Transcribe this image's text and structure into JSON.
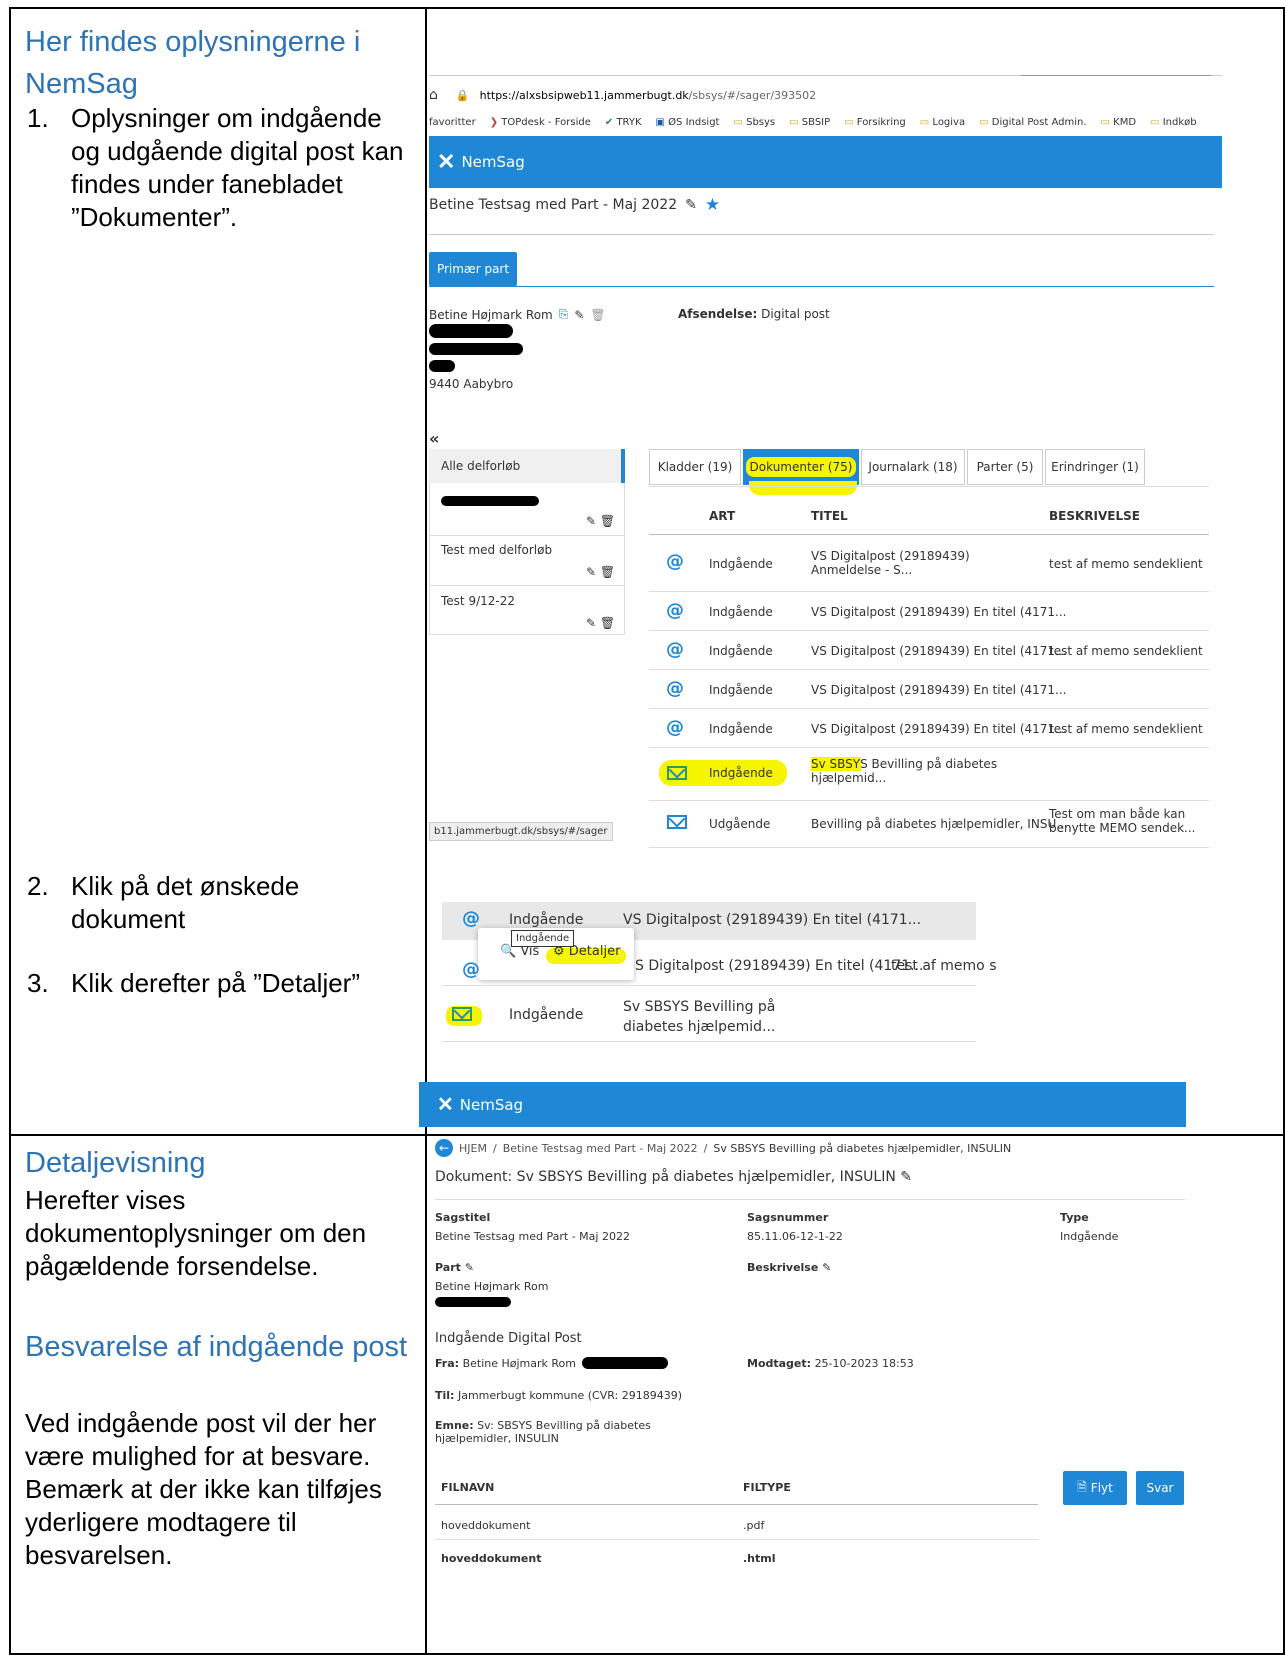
{
  "left": {
    "section1_heading": "Her findes oplysningerne i NemSag",
    "step1_num": "1.",
    "step1_text": "Oplysninger om indgående og udgående digital post kan findes under fanebladet ”Dokumenter”.",
    "step2_num": "2.",
    "step2_text": "Klik på det ønskede dokument",
    "step3_num": "3.",
    "step3_text": "Klik derefter på ”Detaljer”",
    "section2_heading": "Detaljevisning",
    "section2_text": "Herefter vises dokumentoplysninger om den pågældende forsendelse.",
    "section3_heading": "Besvarelse af indgående post",
    "section3_text": "Ved indgående post vil der her være mulighed for at besvare. Bemærk at der ikke kan tilføjes yderligere modtagere til besvarelsen."
  },
  "browser": {
    "url_host": "https://alxsbsipweb11.jammerbugt.dk",
    "url_path": "/sbsys/#/sager/393502",
    "favorites": [
      "favoritter",
      "TOPdesk - Forside",
      "TRYK",
      "ØS Indsigt",
      "Sbsys",
      "SBSIP",
      "Forsikring",
      "Logiva",
      "Digital Post Admin.",
      "KMD",
      "Indkøb"
    ],
    "status_url": "b11.jammerbugt.dk/sbsys/#/sager"
  },
  "nemsag": {
    "app_name": "NemSag",
    "case_title": "Betine Testsag med Part - Maj 2022",
    "primary_part_button": "Primær part",
    "party_name": "Betine Højmark Rom",
    "dispatch_label": "Afsendelse:",
    "dispatch_value": "Digital post",
    "address_city": "9440 Aabybro",
    "collapse": "«",
    "subflows": [
      "Alle delforløb",
      "",
      "Test med delforløb",
      "Test 9/12-22"
    ],
    "tabs": [
      "Kladder (19)",
      "Dokumenter (75)",
      "Journalark (18)",
      "Parter (5)",
      "Erindringer (1)"
    ],
    "columns": [
      "ART",
      "TITEL",
      "BESKRIVELSE"
    ],
    "rows": [
      {
        "art": "Indgående",
        "title": "VS Digitalpost (29189439) Anmeldelse - S...",
        "desc": "test af memo sendeklient"
      },
      {
        "art": "Indgående",
        "title": "VS Digitalpost (29189439) En titel (4171...",
        "desc": ""
      },
      {
        "art": "Indgående",
        "title": "VS Digitalpost (29189439) En titel (4171...",
        "desc": "test af memo sendeklient"
      },
      {
        "art": "Indgående",
        "title": "VS Digitalpost (29189439) En titel (4171...",
        "desc": ""
      },
      {
        "art": "Indgående",
        "title": "VS Digitalpost (29189439) En titel (4171...",
        "desc": "test af memo sendeklient"
      },
      {
        "art": "Indgående",
        "title": "Sv SBSYS Bevilling på diabetes hjælpemid...",
        "desc": ""
      },
      {
        "art": "Udgående",
        "title": "Bevilling på diabetes hjælpemidler, INSU...",
        "desc": "Test om man både kan benytte MEMO sendek..."
      }
    ]
  },
  "popup": {
    "row1_art": "Indgående",
    "row1_title": "VS Digitalpost (29189439) En titel (4171...",
    "tooltip": "Indgående",
    "vis": "Vis",
    "detaljer": "Detaljer",
    "row2_title": "S Digitalpost (29189439) En titel (4171...",
    "row2_desc": "test af memo s",
    "row3_art": "Indgående",
    "row3_title": "Sv SBSYS Bevilling på diabetes hjælpemid..."
  },
  "detail": {
    "app_name": "NemSag",
    "crumb_home": "HJEM",
    "crumb_case": "Betine Testsag med Part - Maj 2022",
    "crumb_doc": "Sv SBSYS Bevilling på diabetes hjælpemidler, INSULIN",
    "doc_title": "Dokument: Sv SBSYS Bevilling på diabetes hjælpemidler, INSULIN",
    "sagstitel_label": "Sagstitel",
    "sagstitel_value": "Betine Testsag med Part - Maj 2022",
    "sagsnummer_label": "Sagsnummer",
    "sagsnummer_value": "85.11.06-12-1-22",
    "type_label": "Type",
    "type_value": "Indgående",
    "part_label": "Part",
    "part_value": "Betine Højmark Rom",
    "beskrivelse_label": "Beskrivelse",
    "post_heading": "Indgående Digital Post",
    "fra_label": "Fra:",
    "fra_value": "Betine Højmark Rom",
    "modtaget_label": "Modtaget:",
    "modtaget_value": "25-10-2023 18:53",
    "til_label": "Til:",
    "til_value": "Jammerbugt kommune (CVR: 29189439)",
    "emne_label": "Emne:",
    "emne_value": "Sv: SBSYS Bevilling på diabetes hjælpemidler, INSULIN",
    "col_filnavn": "FILNAVN",
    "col_filtype": "FILTYPE",
    "files": [
      {
        "name": "hoveddokument",
        "type": ".pdf"
      },
      {
        "name": "hoveddokument",
        "type": ".html"
      }
    ],
    "btn_flyt": "Flyt",
    "btn_svar": "Svar"
  }
}
